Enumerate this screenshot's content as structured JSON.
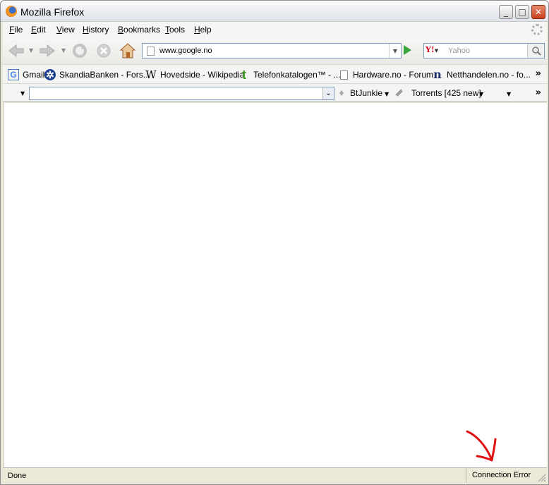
{
  "window": {
    "title": "Mozilla Firefox"
  },
  "menu": {
    "items": [
      "File",
      "Edit",
      "View",
      "History",
      "Bookmarks",
      "Tools",
      "Help"
    ]
  },
  "navigation": {
    "url": "www.google.no",
    "search_placeholder": "Yahoo",
    "search_engine_icon": "Y!"
  },
  "bookmarks": {
    "items": [
      {
        "label": "Gmail",
        "icon": "G"
      },
      {
        "label": "SkandiaBanken - Fors...",
        "icon": "✲"
      },
      {
        "label": "Hovedside - Wikipedia",
        "icon": "W"
      },
      {
        "label": "Telefonkatalogen™ - ...",
        "icon": "t"
      },
      {
        "label": "Hardware.no - Forum",
        "icon": "page"
      },
      {
        "label": "Netthandelen.no - fo...",
        "icon": "n"
      }
    ],
    "overflow": "»"
  },
  "toolbar2": {
    "combo_value": "",
    "btjunkie_label": "BtJunkie",
    "torrents_label": "Torrents [425 new]",
    "overflow": "»"
  },
  "status": {
    "left": "Done",
    "right": "Connection Error"
  },
  "colors": {
    "annotation_arrow": "#e01010",
    "go_button": "#3aa53a",
    "yahoo": "#d0021b"
  }
}
